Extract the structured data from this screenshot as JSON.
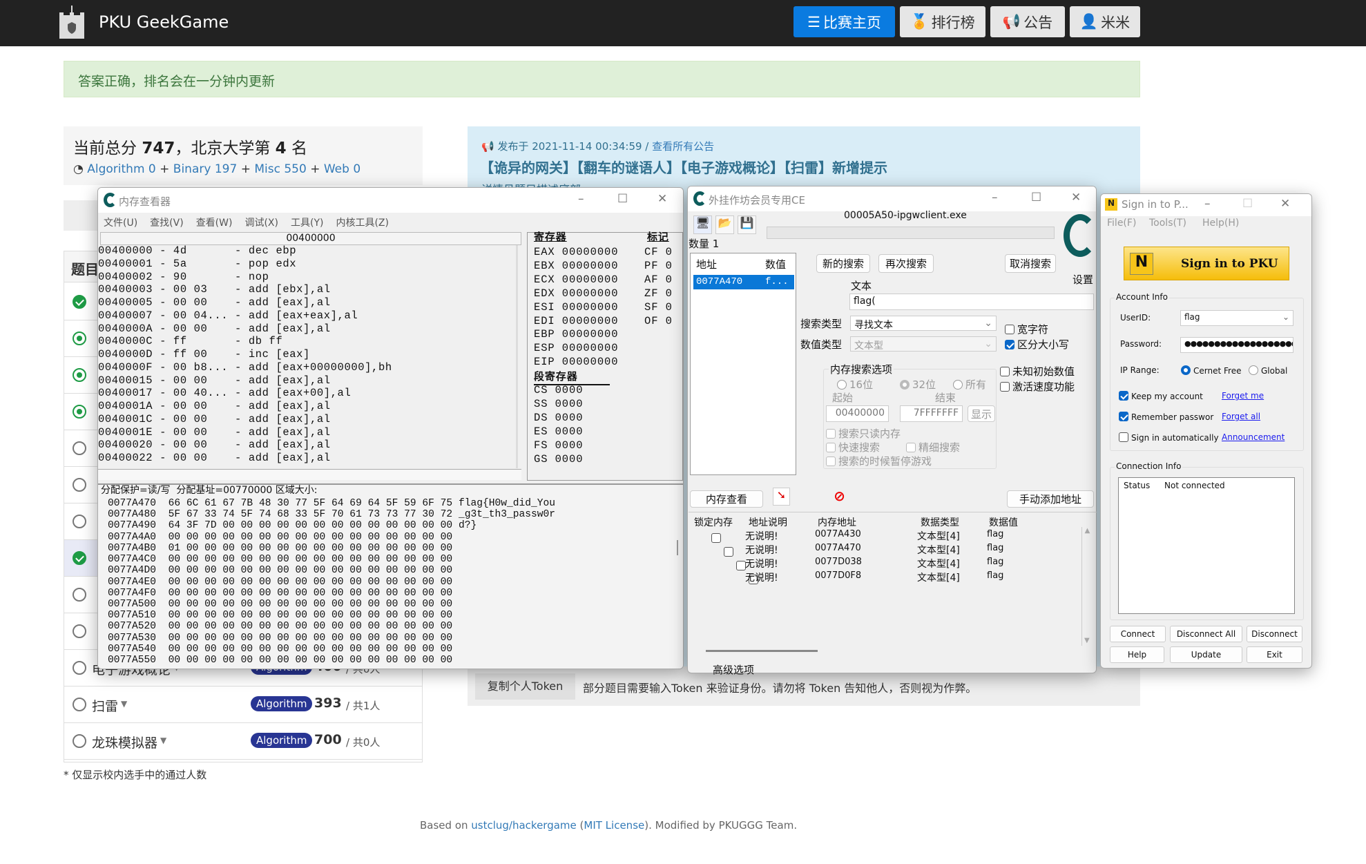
{
  "navbar": {
    "brand": "PKU GeekGame",
    "buttons": [
      {
        "label": "比赛主页",
        "icon": "list-icon",
        "active": true
      },
      {
        "label": "排行榜",
        "icon": "medal-icon"
      },
      {
        "label": "公告",
        "icon": "bullhorn-icon"
      },
      {
        "label": "米米",
        "icon": "user-icon"
      }
    ]
  },
  "alert": {
    "text": "答案正确，排名会在一分钟内更新"
  },
  "score": {
    "prefix": "当前总分 ",
    "total": "747",
    "mid": "，北京大学第 ",
    "rank": "4",
    "suffix": " 名",
    "breakdown": [
      {
        "label": "Algorithm 0"
      },
      {
        "label": "Binary 197"
      },
      {
        "label": "Misc 550"
      },
      {
        "label": "Web 0"
      }
    ],
    "plus": "+"
  },
  "problems": {
    "header": "题目",
    "rows": [
      {
        "status": "solved"
      },
      {
        "status": "partial"
      },
      {
        "status": "partial"
      },
      {
        "status": "partial"
      },
      {
        "status": "none"
      },
      {
        "status": "none"
      },
      {
        "status": "none"
      },
      {
        "status": "solved",
        "highlight": true
      },
      {
        "status": "none"
      },
      {
        "status": "none"
      },
      {
        "status": "none",
        "name": "电子游戏概论",
        "category": "Algorithm",
        "points": "400",
        "count": "/ 共0人"
      },
      {
        "status": "none",
        "name": "扫雷",
        "category": "Algorithm",
        "points": "393",
        "count": "/ 共1人"
      },
      {
        "status": "none",
        "name": "龙珠模拟器",
        "category": "Algorithm",
        "points": "700",
        "count": "/ 共0人"
      }
    ],
    "footnote": "* 仅显示校内选手中的通过人数"
  },
  "announcement": {
    "published": "发布于 2021-11-14 00:34:59 / ",
    "view_all": "查看所有公告",
    "title": "【诡异的网关】【翻车的谜语人】【电子游戏概论】【扫雷】新增提示",
    "detail": "详情见题目描述底部"
  },
  "token": {
    "button": "复制个人Token",
    "text": "部分题目需要输入Token 来验证身份。请勿将 Token 告知他人，否则视为作弊。"
  },
  "footer": {
    "prefix": "Based on ",
    "repo": "ustclug/hackergame",
    "open": " (",
    "license": "MIT License",
    "suffix": "). Modified by PKUGGG Team."
  },
  "memviewer": {
    "title": "内存查看器",
    "menu": [
      "文件(U)",
      "查找(V)",
      "查看(W)",
      "调试(X)",
      "工具(Y)",
      "内核工具(Z)"
    ],
    "address": "00400000",
    "disasm": [
      "00400000 - 4d       - dec ebp",
      "00400001 - 5a       - pop edx",
      "00400002 - 90       - nop",
      "00400003 - 00 03    - add [ebx],al",
      "00400005 - 00 00    - add [eax],al",
      "00400007 - 00 04... - add [eax+eax],al",
      "0040000A - 00 00    - add [eax],al",
      "0040000C - ff       - db ff",
      "0040000D - ff 00    - inc [eax]",
      "0040000F - 00 b8... - add [eax+00000000],bh",
      "00400015 - 00 00    - add [eax],al",
      "00400017 - 00 40... - add [eax+00],al",
      "0040001A - 00 00    - add [eax],al",
      "0040001C - 00 00    - add [eax],al",
      "0040001E - 00 00    - add [eax],al",
      "00400020 - 00 00    - add [eax],al",
      "00400022 - 00 00    - add [eax],al"
    ],
    "registers_label": "寄存器",
    "flags_label": "标记",
    "segment_label": "段寄存器",
    "registers": [
      "EAX 00000000",
      "EBX 00000000",
      "ECX 00000000",
      "EDX 00000000",
      "ESI 00000000",
      "EDI 00000000",
      "EBP 00000000",
      "ESP 00000000",
      "EIP 00000000"
    ],
    "flags": [
      "CF 0",
      "PF 0",
      "AF 0",
      "ZF 0",
      "SF 0",
      "OF 0"
    ],
    "segments": [
      "CS 0000",
      "SS 0000",
      "DS 0000",
      "ES 0000",
      "FS 0000",
      "GS 0000"
    ],
    "hex_header": "分配保护=读/写  分配基址=00770000 区域大小:",
    "hex": [
      "0077A470  66 6C 61 67 7B 48 30 77 5F 64 69 64 5F 59 6F 75 flag{H0w_did_You",
      "0077A480  5F 67 33 74 5F 74 68 33 5F 70 61 73 73 77 30 72 _g3t_th3_passw0r",
      "0077A490  64 3F 7D 00 00 00 00 00 00 00 00 00 00 00 00 00 d?}",
      "0077A4A0  00 00 00 00 00 00 00 00 00 00 00 00 00 00 00 00",
      "0077A4B0  01 00 00 00 00 00 00 00 00 00 00 00 00 00 00 00",
      "0077A4C0  00 00 00 00 00 00 00 00 00 00 00 00 00 00 00 00",
      "0077A4D0  00 00 00 00 00 00 00 00 00 00 00 00 00 00 00 00",
      "0077A4E0  00 00 00 00 00 00 00 00 00 00 00 00 00 00 00 00",
      "0077A4F0  00 00 00 00 00 00 00 00 00 00 00 00 00 00 00 00",
      "0077A500  00 00 00 00 00 00 00 00 00 00 00 00 00 00 00 00",
      "0077A510  00 00 00 00 00 00 00 00 00 00 00 00 00 00 00 00",
      "0077A520  00 00 00 00 00 00 00 00 00 00 00 00 00 00 00 00",
      "0077A530  00 00 00 00 00 00 00 00 00 00 00 00 00 00 00 00",
      "0077A540  00 00 00 00 00 00 00 00 00 00 00 00 00 00 00 00",
      "0077A550  00 00 00 00 00 00 00 00 00 00 00 00 00 00 00 00"
    ]
  },
  "ce": {
    "title": "外挂作坊会员专用CE",
    "process": "00005A50-ipgwclient.exe",
    "count_label": "数量 1",
    "settings": "设置",
    "found_headers": [
      "地址",
      "数值"
    ],
    "found_rows": [
      {
        "address": "0077A470",
        "value": "f..."
      }
    ],
    "new_scan": "新的搜索",
    "next_scan": "再次搜索",
    "cancel_scan": "取消搜索",
    "text_label": "文本",
    "text_value": "flag(",
    "scan_type_label": "搜索类型",
    "scan_type": "寻找文本",
    "value_type_label": "数值类型",
    "value_type": "文本型",
    "wide_char": "宽字符",
    "case_sensitive": "区分大小写",
    "mem_options": "内存搜索选项",
    "bits": [
      "16位",
      "32位",
      "所有"
    ],
    "start_label": "起始",
    "end_label": "结束",
    "start": "00400000",
    "end": "7FFFFFFF",
    "show": "显示",
    "readonly": "搜索只读内存",
    "fast": "快速搜索",
    "fine": "精细搜索",
    "pause": "搜索的时候暂停游戏",
    "unknown_initial": "未知初始数值",
    "speedhack": "激活速度功能",
    "memory_view": "内存查看",
    "add_manual": "手动添加地址",
    "table_headers": [
      "锁定内存",
      "地址说明",
      "内存地址",
      "数据类型",
      "数据值"
    ],
    "table_rows": [
      {
        "desc": "无说明!",
        "address": "0077A430",
        "type": "文本型[4]",
        "value": "flag"
      },
      {
        "desc": "无说明!",
        "address": "0077A470",
        "type": "文本型[4]",
        "value": "flag"
      },
      {
        "desc": "无说明!",
        "address": "0077D038",
        "type": "文本型[4]",
        "value": "flag"
      },
      {
        "desc": "无说明!",
        "address": "0077D0F8",
        "type": "文本型[4]",
        "value": "flag"
      }
    ],
    "advanced": "高级选项"
  },
  "signin": {
    "title": "Sign in to P...",
    "menu": [
      "File(F)",
      "Tools(T)",
      "Help(H)"
    ],
    "button": "Sign in to PKU",
    "account_info": "Account Info",
    "userid_label": "UserID:",
    "userid": "flag",
    "password_label": "Password:",
    "password": "●●●●●●●●●●●●●●●●●●●●",
    "ip_label": "IP Range:",
    "ip_options": [
      "Cernet Free",
      "Global"
    ],
    "keep": "Keep my account",
    "remember": "Remember passwor",
    "auto": "Sign in automatically",
    "forget_me": "Forget me",
    "forget_all": "Forget all",
    "announcement": "Announcement",
    "connection_info": "Connection Info",
    "status_label": "Status",
    "status": "Not connected",
    "buttons": [
      "Connect",
      "Disconnect All",
      "Disconnect",
      "Help",
      "Update",
      "Exit"
    ]
  },
  "colors": {
    "nav_bg": "#222222",
    "accent": "#0a7be0",
    "alert_bg": "#dff0d8",
    "badge": "#283593",
    "success": "#1e9b45",
    "signin_yellow": "#f7c51a"
  }
}
